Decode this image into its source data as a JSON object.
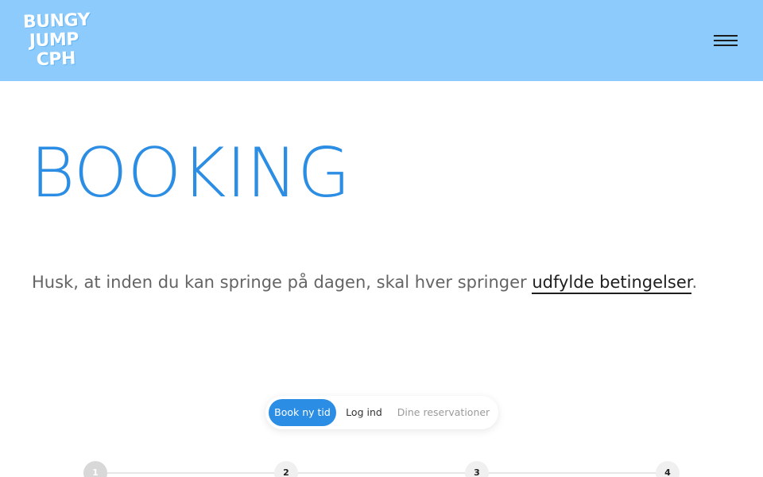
{
  "header": {
    "logo_lines": [
      "BUNGY",
      "JUMP",
      "CPH"
    ],
    "menu_icon": "hamburger-menu-icon",
    "background_color": "#8ecbfd"
  },
  "main": {
    "title": "BOOKING",
    "notice_text": "Husk, at inden du kan springe på dagen, skal hver springer ",
    "notice_link": "udfylde betingelser",
    "notice_end": "."
  },
  "tabs": [
    {
      "label": "Book ny tid",
      "active": true
    },
    {
      "label": "Log ind",
      "active": false
    },
    {
      "label": "Dine reservationer",
      "active": false
    }
  ],
  "steps": [
    "1",
    "2",
    "3",
    "4"
  ],
  "colors": {
    "accent": "#2b8de3",
    "header": "#8ecbfd",
    "text": "#646464"
  }
}
